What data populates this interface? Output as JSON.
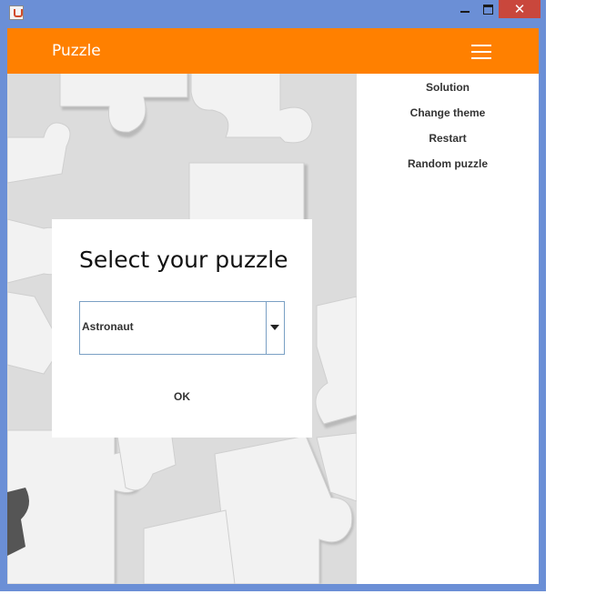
{
  "window": {
    "controls": {
      "close_glyph": "✕"
    }
  },
  "header": {
    "title": "Puzzle",
    "color": "#ff8000",
    "menu_icon": "hamburger-menu-icon"
  },
  "side_menu": {
    "items": [
      {
        "label": "Solution"
      },
      {
        "label": "Change theme"
      },
      {
        "label": "Restart"
      },
      {
        "label": "Random puzzle"
      }
    ]
  },
  "dialog": {
    "title": "Select your puzzle",
    "select": {
      "value": "Astronaut"
    },
    "ok_label": "OK"
  }
}
